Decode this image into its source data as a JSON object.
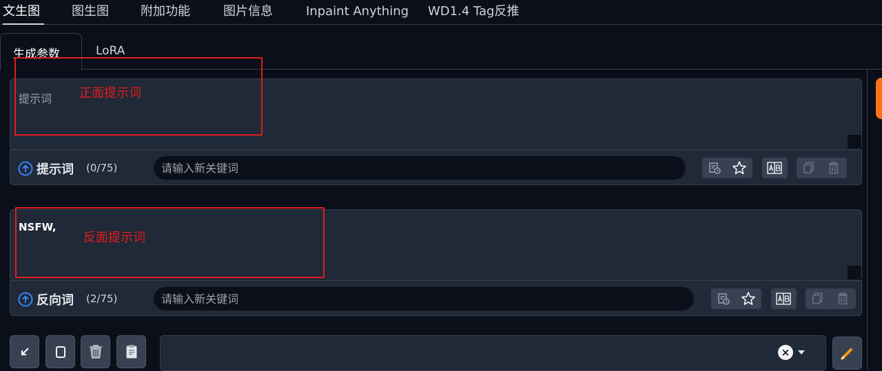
{
  "top_tabs": [
    {
      "label": "文生图",
      "active": true
    },
    {
      "label": "图生图",
      "active": false
    },
    {
      "label": "附加功能",
      "active": false
    },
    {
      "label": "图片信息",
      "active": false
    },
    {
      "label": "Inpaint Anything",
      "active": false
    },
    {
      "label": "WD1.4 Tag反推",
      "active": false
    }
  ],
  "sub_tabs": [
    {
      "label": "生成参数",
      "active": true
    },
    {
      "label": "LoRA",
      "active": false
    }
  ],
  "positive": {
    "placeholder": "提示词",
    "value": "",
    "toolbar_title": "提示词",
    "count": "(0/75)",
    "keyword_placeholder": "请输入新关键词",
    "annotation": "正面提示词"
  },
  "negative": {
    "value": "NSFW,",
    "toolbar_title": "反向词",
    "count": "(2/75)",
    "keyword_placeholder": "请输入新关键词",
    "annotation": "反面提示词"
  },
  "icons": [
    "history-icon",
    "star-icon",
    "translate-icon",
    "copy-icon",
    "trash-icon"
  ],
  "bottom_buttons": [
    "arrow-down-left-icon",
    "clipboard-icon",
    "trash-icon",
    "paste-icon"
  ],
  "colors": {
    "accent": "#f97316",
    "annotation": "#e11d1d",
    "arrow_icon": "#3b82f6"
  }
}
